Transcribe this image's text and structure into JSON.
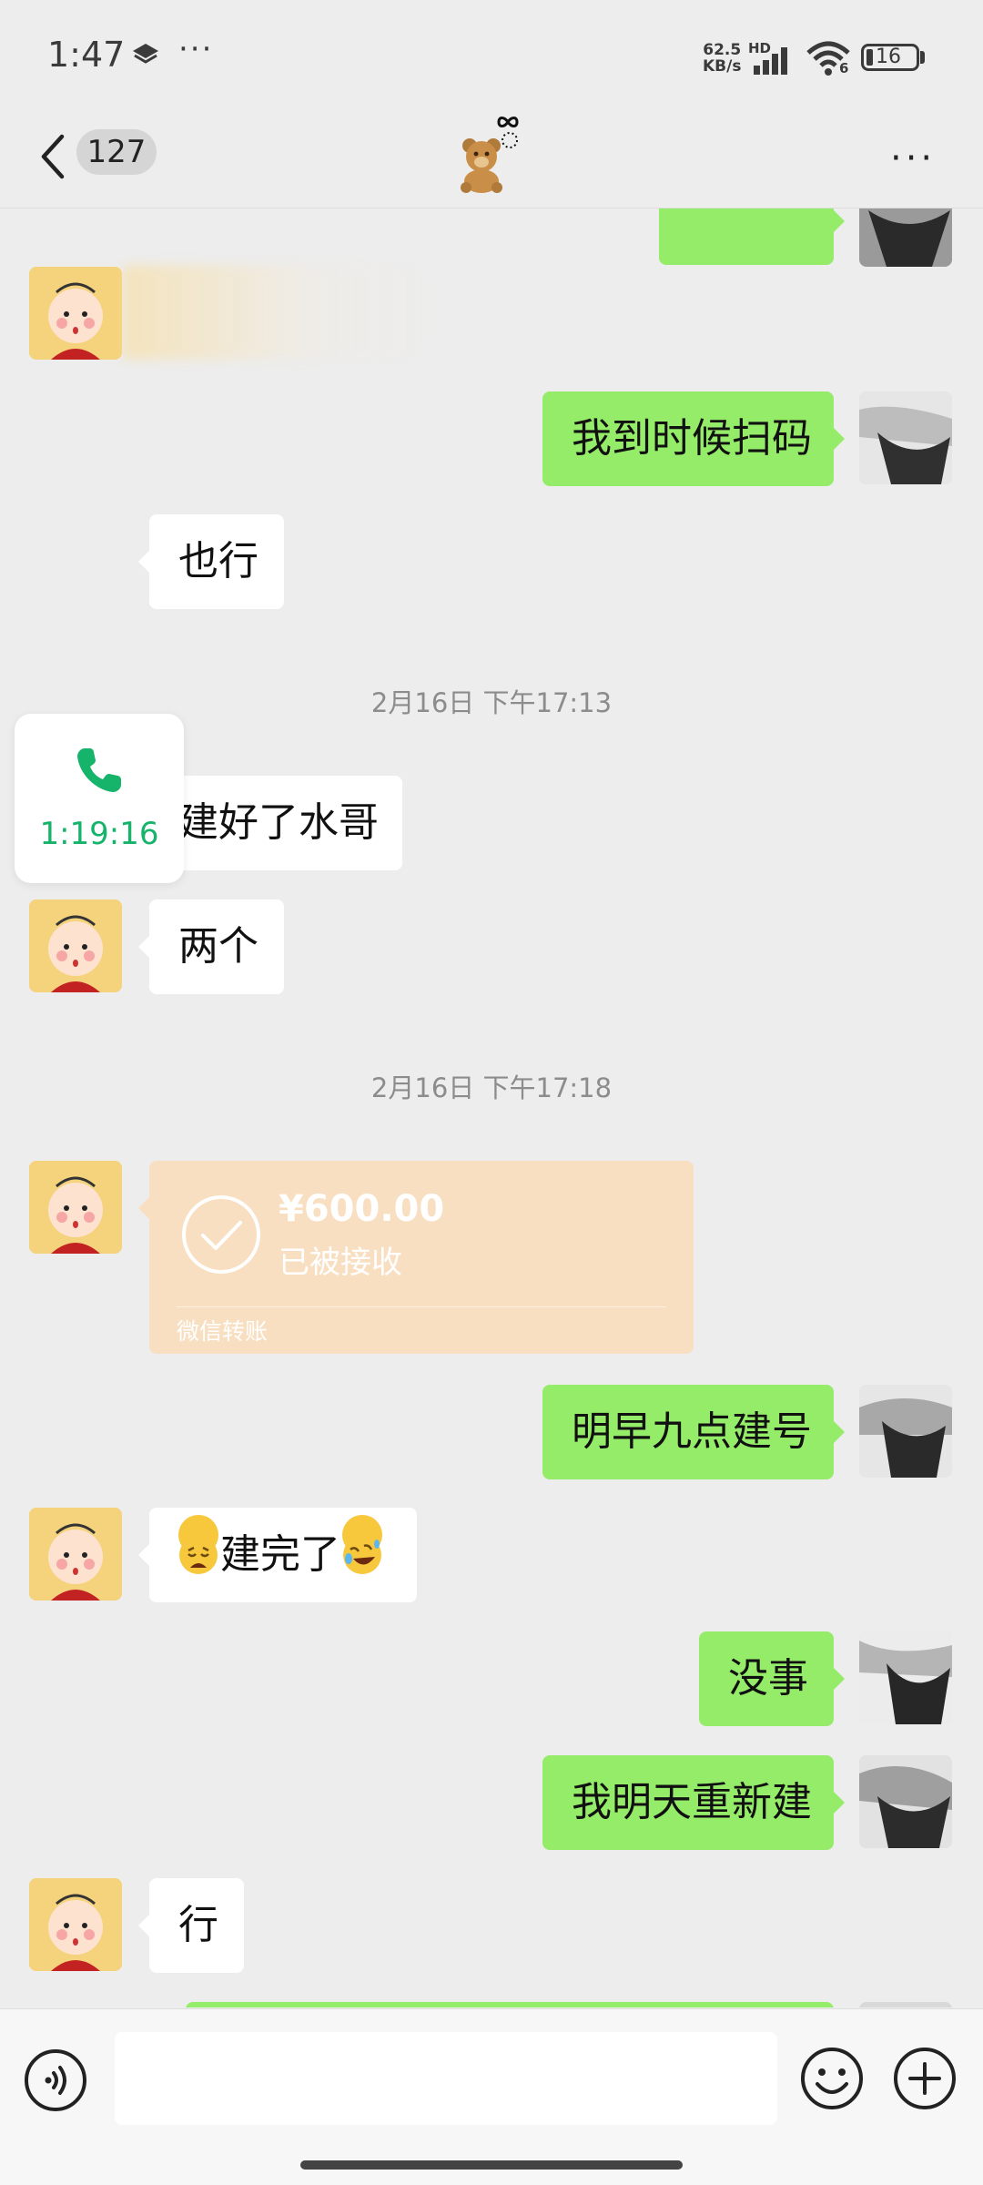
{
  "status_bar": {
    "time": "1:47",
    "overflow_dots": "···",
    "net_speed_value": "62.5",
    "net_speed_unit": "KB/s",
    "hd_label": "HD",
    "wifi_label": "6",
    "battery": "16"
  },
  "nav": {
    "unread_count": "127",
    "title_icon": "teddy-bear-emoji",
    "more": "···"
  },
  "messages": [
    {
      "side": "right",
      "text": "",
      "partial": true
    },
    {
      "side": "left",
      "type": "blurred-image"
    },
    {
      "side": "right",
      "text": "我到时候扫码"
    },
    {
      "side": "left",
      "text": "也行"
    },
    {
      "type": "timestamp",
      "text": "2月16日 下午17:13"
    },
    {
      "side": "left",
      "text": "建好了水哥"
    },
    {
      "side": "left",
      "text": "两个"
    },
    {
      "type": "timestamp",
      "text": "2月16日 下午17:18"
    },
    {
      "side": "left",
      "type": "transfer"
    },
    {
      "side": "right",
      "text": "明早九点建号"
    },
    {
      "side": "left",
      "text": "建完了",
      "emoji_before": "weary-face",
      "emoji_after": "rolling-laughing-face"
    },
    {
      "side": "right",
      "text": "没事"
    },
    {
      "side": "right",
      "text": "我明天重新建"
    },
    {
      "side": "left",
      "text": "行"
    }
  ],
  "call": {
    "duration": "1:19:16",
    "icon": "phone-icon",
    "color": "#16b36b"
  },
  "transfer": {
    "amount": "¥600.00",
    "status": "已被接收",
    "label": "微信转账",
    "color": "#f9dfc1"
  },
  "input": {
    "placeholder": ""
  },
  "colors": {
    "background": "#ededed",
    "bubble_self": "#95ec69",
    "bubble_other": "#ffffff",
    "timestamp": "#8c8c8c"
  }
}
